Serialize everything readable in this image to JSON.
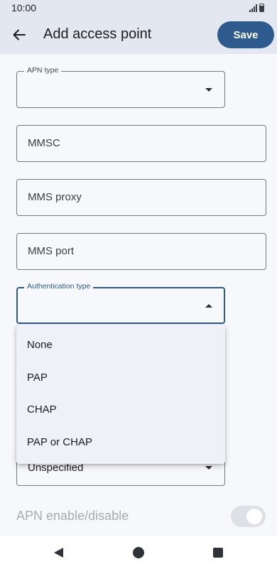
{
  "status_bar": {
    "time": "10:00",
    "signal_icon": "signal-icon",
    "battery_icon": "battery-icon"
  },
  "app_bar": {
    "title": "Add access point",
    "save_label": "Save",
    "back_icon": "arrow-back-icon"
  },
  "fields": {
    "apn_type": {
      "label": "APN type",
      "value": ""
    },
    "mmsc": {
      "placeholder": "MMSC"
    },
    "mms_proxy": {
      "placeholder": "MMS proxy"
    },
    "mms_port": {
      "placeholder": "MMS port"
    },
    "authentication_type": {
      "label": "Authentication type",
      "value": "",
      "options": [
        "None",
        "PAP",
        "CHAP",
        "PAP or CHAP"
      ]
    },
    "next_dropdown": {
      "value": "Unspecified"
    }
  },
  "toggle": {
    "label": "APN enable/disable",
    "state": "on",
    "enabled": false
  },
  "nav_bar": {
    "back_icon": "nav-back-icon",
    "home_icon": "nav-home-icon",
    "recents_icon": "nav-recents-icon"
  },
  "colors": {
    "accent": "#2d5b8e",
    "background": "#f6f8fb",
    "app_bar": "#e3e8f0"
  }
}
